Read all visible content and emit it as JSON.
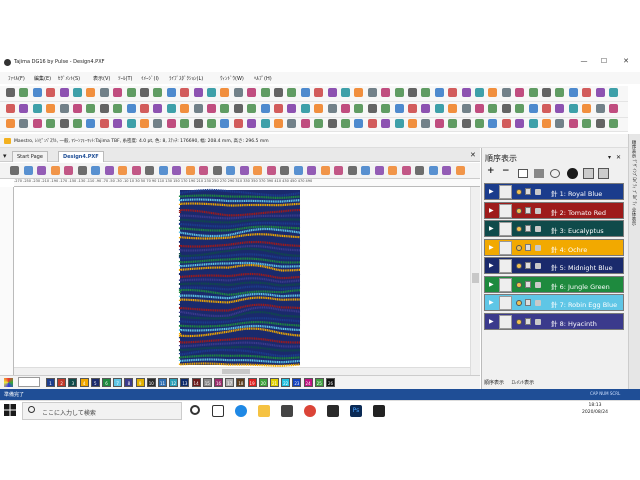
{
  "app": {
    "title": "Tajima DG16 by Pulse - Design4.PXF",
    "minimize": "—",
    "maximize": "☐",
    "close": "✕"
  },
  "menu": {
    "items": [
      "ﾌｧｲﾙ(F)",
      "編集(E)",
      "ｾｸﾞﾒﾝﾄ(S)",
      "表示(V)",
      "ﾂｰﾙ(T)",
      "ｲﾒｰｼﾞ(I)",
      "ﾗｲﾌﾞｽﾀﾞｸｼｮﾝ(L)",
      "ｳｨﾝﾄﾞｳ(W)",
      "ﾍﾙﾌﾟ(H)"
    ]
  },
  "info": {
    "text": "Maestro, ﾚｼﾋﾟ:ﾊﾟｽﾃﾙ, 一般, ﾏｼｰﾝﾌｫｰﾏｯﾄ:Tajima TBF, 糸密度: 4.0 pt, 色: 8, ｽﾃｯﾁ: 176690, 幅: 208.4 mm, 高さ: 296.5 mm"
  },
  "tabs": [
    {
      "label": "Start Page"
    },
    {
      "label": "Design4.PXF"
    }
  ],
  "ruler": {
    "labels": "-270 -250 -230 -210 -190 -170 -150 -130 -110 -90 -70 -50 -30 -10 10 30 50 70 90 110 130 150 170 190 210 230 250 270 290 310 330 350 370 390 410 430 450 470 490"
  },
  "sequence_panel": {
    "title": "順序表示",
    "rows": [
      {
        "label": "針 1: Royal Blue",
        "color": "#1b3c8c"
      },
      {
        "label": "針 2: Tomato Red",
        "color": "#9e1b1b"
      },
      {
        "label": "針 3: Eucalyptus",
        "color": "#0f4a4a"
      },
      {
        "label": "針 4: Ochre",
        "color": "#f2a900"
      },
      {
        "label": "針 5: Midnight Blue",
        "color": "#1a2a6c"
      },
      {
        "label": "針 6: Jungle Green",
        "color": "#1e8a3e"
      },
      {
        "label": "針 7: Robin Egg Blue",
        "color": "#5fc6e6"
      },
      {
        "label": "針 8: Hyacinth",
        "color": "#3b3a8c"
      }
    ],
    "bottom_tabs": [
      "順序表示",
      "ｴﾚﾒﾝﾄ表示"
    ]
  },
  "vertical_tabs": "順序表示 ﾃﾞｻﾞｲﾝﾌﾟﾛﾊﾟﾃｨ ﾌﾟﾛﾊﾟﾃｨ 全体表示",
  "palette": {
    "swatches": [
      {
        "n": "1",
        "c": "#1b3c8c"
      },
      {
        "n": "2",
        "c": "#c0392b"
      },
      {
        "n": "3",
        "c": "#0f4a4a"
      },
      {
        "n": "4",
        "c": "#f2a900"
      },
      {
        "n": "5",
        "c": "#1a2a6c"
      },
      {
        "n": "6",
        "c": "#1e8a3e"
      },
      {
        "n": "7",
        "c": "#5fc6e6"
      },
      {
        "n": "8",
        "c": "#3b3a8c"
      },
      {
        "n": "9",
        "c": "#e0b000"
      },
      {
        "n": "10",
        "c": "#2a2a2a"
      },
      {
        "n": "11",
        "c": "#2f6fb3"
      },
      {
        "n": "12",
        "c": "#2ba0b8"
      },
      {
        "n": "13",
        "c": "#0c2a6a"
      },
      {
        "n": "14",
        "c": "#6a1a1a"
      },
      {
        "n": "15",
        "c": "#8a8a8a"
      },
      {
        "n": "16",
        "c": "#9a2a6a"
      },
      {
        "n": "17",
        "c": "#b0b0b0"
      },
      {
        "n": "18",
        "c": "#5a3a1a"
      },
      {
        "n": "19",
        "c": "#e02020"
      },
      {
        "n": "20",
        "c": "#3aa03a"
      },
      {
        "n": "21",
        "c": "#e0d000"
      },
      {
        "n": "22",
        "c": "#20c0e0"
      },
      {
        "n": "23",
        "c": "#1040c0"
      },
      {
        "n": "24",
        "c": "#c01080"
      },
      {
        "n": "25",
        "c": "#40a040"
      },
      {
        "n": "26",
        "c": "#101010"
      }
    ]
  },
  "status": {
    "text": "準備完了",
    "right": "CAP NUM SCRL"
  },
  "taskbar": {
    "search_placeholder": "ここに入力して検索",
    "time": "18:13",
    "date": "2020/08/24"
  }
}
